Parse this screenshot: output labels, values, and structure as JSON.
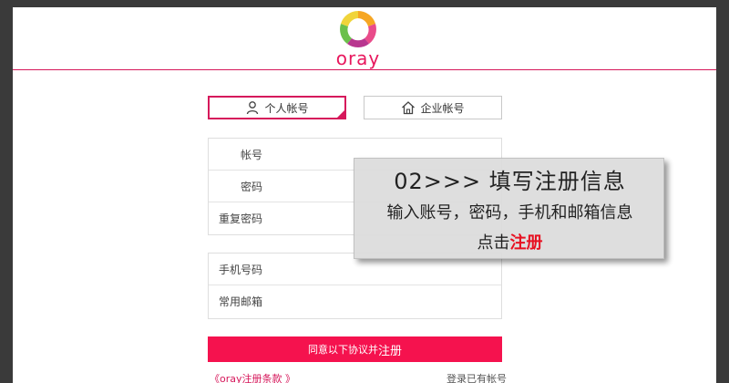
{
  "brand": {
    "logo_text": "oray",
    "accent": "#e8175d"
  },
  "tabs": {
    "personal_label": "个人帐号",
    "company_label": "企业帐号"
  },
  "form": {
    "account_label": "帐号",
    "password_label": "密码",
    "confirm_password_label": "重复密码",
    "phone_label": "手机号码",
    "email_label": "常用邮箱"
  },
  "submit": {
    "prefix": "同意以下协议并",
    "action": "注册",
    "color": "#f5124e"
  },
  "footer": {
    "terms_link": "《oray注册条款 》",
    "login_link": "登录已有帐号"
  },
  "overlay": {
    "title": "02>>>  填写注册信息",
    "line1": "输入账号，密码，手机和邮箱信息",
    "action_prefix": "点击",
    "action_highlight": "注册"
  }
}
